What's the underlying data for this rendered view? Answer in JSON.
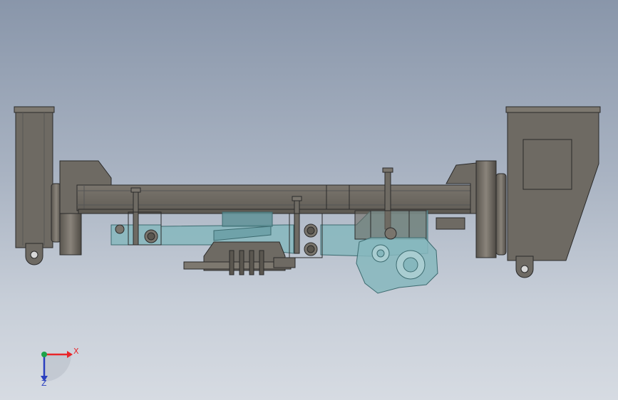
{
  "triad": {
    "x_label": "X",
    "z_label": "Z",
    "x_color": "#e8262a",
    "y_color": "#1ea34a",
    "z_color": "#2a3fbf"
  },
  "colors": {
    "steel": "#6e6a63",
    "steel_dark": "#4f4b45",
    "steel_light": "#857f77",
    "glass": "#86b7bd",
    "glass_dark": "#5f9298",
    "outline": "#2a2a2a"
  },
  "parts": [
    "left-wheel-hub",
    "left-spring-bracket",
    "main-frame-beam",
    "right-wheel-hub",
    "right-gear-housing",
    "transparent-axle-tube",
    "differential-housing",
    "center-bracket-assembly"
  ]
}
